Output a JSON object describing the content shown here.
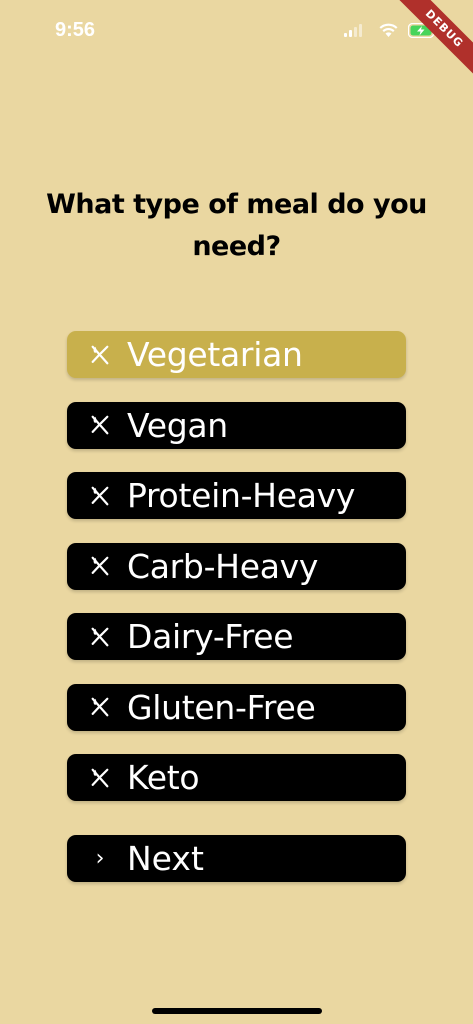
{
  "status_bar": {
    "time": "9:56"
  },
  "debug_banner": "DEBUG",
  "question": "What type of meal do you need?",
  "options": [
    {
      "label": "Vegetarian",
      "selected": true
    },
    {
      "label": "Vegan",
      "selected": false
    },
    {
      "label": "Protein-Heavy",
      "selected": false
    },
    {
      "label": "Carb-Heavy",
      "selected": false
    },
    {
      "label": "Dairy-Free",
      "selected": false
    },
    {
      "label": "Gluten-Free",
      "selected": false
    },
    {
      "label": "Keto",
      "selected": false
    }
  ],
  "option_icon": "restaurant-icon",
  "next_button": {
    "label": "Next",
    "icon": "chevron-right-icon"
  },
  "colors": {
    "background": "#ead7a1",
    "button": "#000000",
    "selected_button": "#c8b04c",
    "button_text": "#ffffff"
  }
}
